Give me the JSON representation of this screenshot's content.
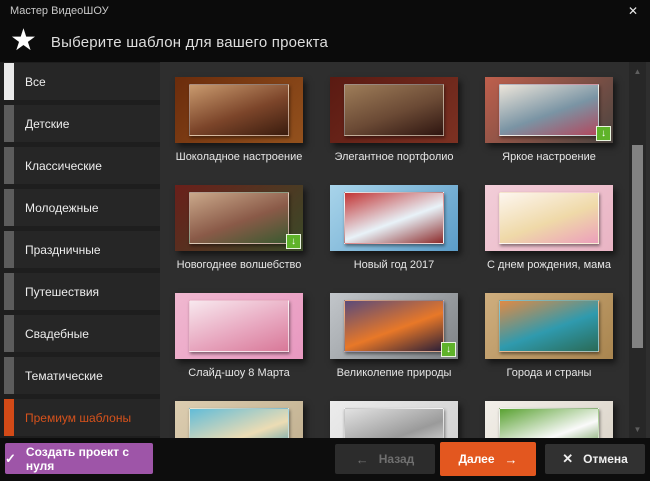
{
  "window": {
    "title": "Мастер ВидеоШОУ"
  },
  "header": {
    "title": "Выберите шаблон для вашего проекта"
  },
  "icons": {
    "close": "✕",
    "star": "★",
    "check": "✓",
    "back_arrow": "←",
    "next_arrow": "→",
    "cancel_x": "✕",
    "scroll_up": "▲",
    "scroll_down": "▼",
    "download": "↓"
  },
  "sidebar": {
    "items": [
      {
        "id": "all",
        "label": "Все",
        "state": "selected"
      },
      {
        "id": "kids",
        "label": "Детские",
        "state": ""
      },
      {
        "id": "classic",
        "label": "Классические",
        "state": ""
      },
      {
        "id": "youth",
        "label": "Молодежные",
        "state": ""
      },
      {
        "id": "holiday",
        "label": "Праздничные",
        "state": ""
      },
      {
        "id": "travel",
        "label": "Путешествия",
        "state": ""
      },
      {
        "id": "wedding",
        "label": "Свадебные",
        "state": ""
      },
      {
        "id": "thematic",
        "label": "Тематические",
        "state": ""
      },
      {
        "id": "premium",
        "label": "Премиум шаблоны",
        "state": "premium"
      }
    ]
  },
  "templates": [
    {
      "label": "Шоколадное настроение",
      "badge": false,
      "frame": [
        "#6b2c0c",
        "#93511d"
      ],
      "photo": [
        "#c99a6e",
        "#7c452a",
        "#3a1c0e"
      ]
    },
    {
      "label": "Элегантное портфолио",
      "badge": false,
      "frame": [
        "#5a1a12",
        "#7c3122"
      ],
      "photo": [
        "#9e7d59",
        "#6b4a35",
        "#2e1510"
      ]
    },
    {
      "label": "Яркое настроение",
      "badge": true,
      "frame": [
        "#bf5f4c",
        "#4a4440"
      ],
      "photo": [
        "#ece5da",
        "#7a94a4",
        "#b2485e"
      ]
    },
    {
      "label": "Новогоднее волшебство",
      "badge": true,
      "frame": [
        "#6a1f1a",
        "#3a4a28"
      ],
      "photo": [
        "#caa88a",
        "#8a5a48",
        "#3a5a30"
      ]
    },
    {
      "label": "Новый год 2017",
      "badge": false,
      "frame": [
        "#a8d4ea",
        "#5b9cc8"
      ],
      "photo": [
        "#c23434",
        "#e8f2f8",
        "#8c2a2a"
      ]
    },
    {
      "label": "С днем рождения, мама",
      "badge": false,
      "frame": [
        "#f2cdd8",
        "#e9b4c4"
      ],
      "photo": [
        "#fdf6ef",
        "#efd9a8",
        "#ec9fbb"
      ]
    },
    {
      "label": "Слайд-шоу 8 Марта",
      "badge": false,
      "frame": [
        "#f0b8d0",
        "#e898c0"
      ],
      "photo": [
        "#f8e8ee",
        "#e8a8c0",
        "#d87898"
      ]
    },
    {
      "label": "Великолепие природы",
      "badge": true,
      "frame": [
        "#c2c6ca",
        "#7e8286"
      ],
      "photo": [
        "#5a4a7a",
        "#e87828",
        "#2a1f38"
      ]
    },
    {
      "label": "Города и страны",
      "badge": false,
      "frame": [
        "#cfae7e",
        "#a9854f"
      ],
      "photo": [
        "#e08a45",
        "#2f9aae",
        "#2a6a56"
      ]
    },
    {
      "label": "",
      "badge": false,
      "frame": [
        "#dccdb0",
        "#bfae8e"
      ],
      "photo": [
        "#62bcd8",
        "#ecdcb4",
        "#2a8aa8"
      ]
    },
    {
      "label": "",
      "badge": false,
      "frame": [
        "#ececec",
        "#cfcfcf"
      ],
      "photo": [
        "#e2e2e2",
        "#9a9a9a",
        "#f4f4f4"
      ]
    },
    {
      "label": "",
      "badge": false,
      "frame": [
        "#f2efe9",
        "#d9d2c6"
      ],
      "photo": [
        "#5aa232",
        "#fafafa",
        "#3c7a1c"
      ]
    }
  ],
  "footer": {
    "create_label": "Создать проект с нуля",
    "back_label": "Назад",
    "next_label": "Далее",
    "cancel_label": "Отмена"
  },
  "colors": {
    "accent_orange": "#e3571f",
    "premium_orange": "#d6521c",
    "purple": "#9e55a8",
    "badge_green": "#5fb32a",
    "content_bg": "#2e2e2e",
    "sidebar_tile": "#262626"
  }
}
